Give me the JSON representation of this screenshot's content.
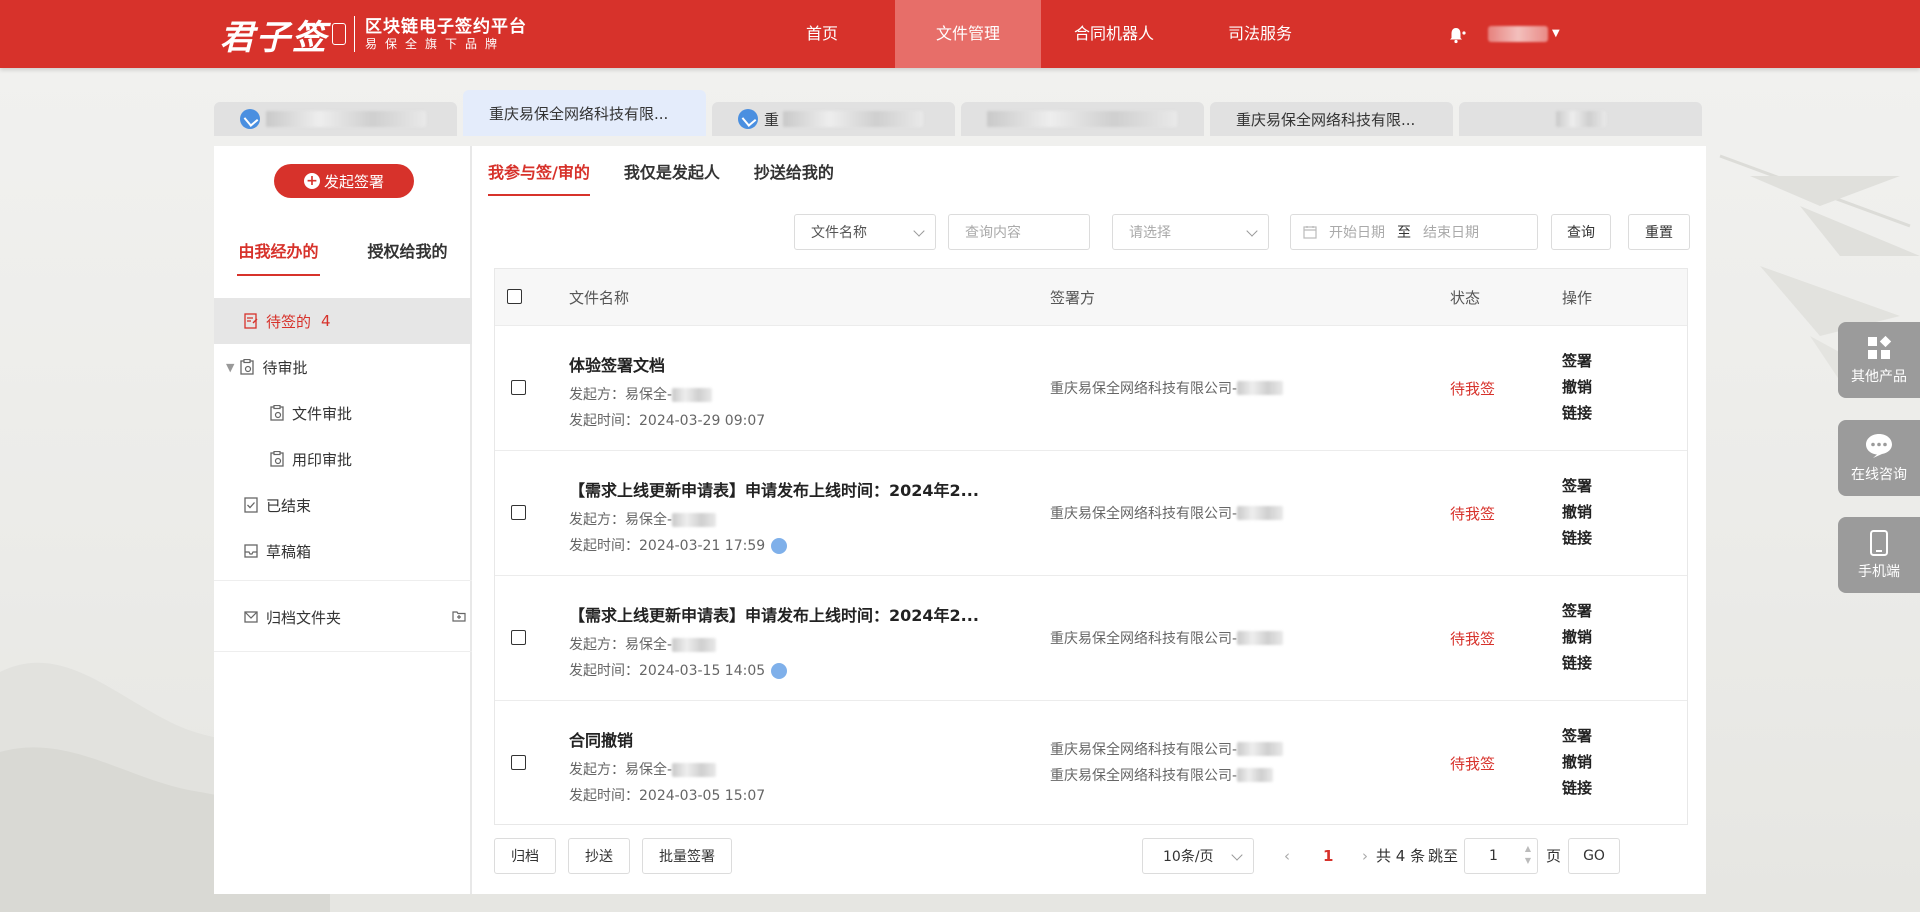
{
  "header": {
    "logo_brand": "君子签",
    "logo_title": "区块链电子签约平台",
    "logo_subtitle": "易保全旗下品牌",
    "nav": [
      "首页",
      "文件管理",
      "合同机器人",
      "司法服务"
    ],
    "active_nav": 1
  },
  "tabs": [
    {
      "label": "",
      "icon": true,
      "blurred": true
    },
    {
      "label": "重庆易保全网络科技有限...",
      "icon": false,
      "active": true
    },
    {
      "label": "重",
      "icon": true,
      "blurred": true
    },
    {
      "label": "",
      "icon": false,
      "blurred": true
    },
    {
      "label": "重庆易保全网络科技有限...",
      "icon": false
    },
    {
      "label": "",
      "icon": false,
      "blurred": true
    }
  ],
  "sidebar": {
    "start_button": "发起签署",
    "tab_mine": "由我经办的",
    "tab_authorized": "授权给我的",
    "items": [
      {
        "label": "待签的",
        "count": "4",
        "icon": "edit-doc-icon"
      },
      {
        "label": "待审批",
        "icon": "approval-icon"
      },
      {
        "label": "文件审批",
        "icon": "file-approval-icon"
      },
      {
        "label": "用印审批",
        "icon": "seal-approval-icon"
      },
      {
        "label": "已结束",
        "icon": "finished-icon"
      },
      {
        "label": "草稿箱",
        "icon": "draft-icon"
      }
    ],
    "archive": "归档文件夹"
  },
  "content": {
    "tabs": [
      "我参与签/审的",
      "我仅是发起人",
      "抄送给我的"
    ],
    "filters": {
      "field_select": "文件名称",
      "query_placeholder": "查询内容",
      "select_placeholder": "请选择",
      "start_date": "开始日期",
      "to": "至",
      "end_date": "结束日期",
      "query_btn": "查询",
      "reset_btn": "重置"
    },
    "columns": {
      "name": "文件名称",
      "signer": "签署方",
      "status": "状态",
      "ops": "操作"
    },
    "rows": [
      {
        "name": "体验签署文档",
        "initiator": "发起方：易保全-",
        "time": "发起时间：2024-03-29 09:07",
        "signers": [
          "重庆易保全网络科技有限公司-"
        ],
        "status": "待我签",
        "pin": false
      },
      {
        "name": "【需求上线更新申请表】申请发布上线时间：2024年2...",
        "initiator": "发起方：易保全-",
        "time": "发起时间：2024-03-21 17:59",
        "signers": [
          "重庆易保全网络科技有限公司-"
        ],
        "status": "待我签",
        "pin": true
      },
      {
        "name": "【需求上线更新申请表】申请发布上线时间：2024年2...",
        "initiator": "发起方：易保全-",
        "time": "发起时间：2024-03-15 14:05",
        "signers": [
          "重庆易保全网络科技有限公司-"
        ],
        "status": "待我签",
        "pin": true
      },
      {
        "name": "合同撤销",
        "initiator": "发起方：易保全-",
        "time": "发起时间：2024-03-05 15:07",
        "signers": [
          "重庆易保全网络科技有限公司-",
          "重庆易保全网络科技有限公司-"
        ],
        "status": "待我签",
        "pin": false
      }
    ],
    "ops": [
      "签署",
      "撤销",
      "链接"
    ],
    "footer": {
      "archive": "归档",
      "cc": "抄送",
      "batch_sign": "批量签署",
      "page_size": "10条/页",
      "current_page": "1",
      "total": "共 4 条",
      "jump_to": "跳至",
      "jump_value": "1",
      "page_unit": "页",
      "go": "GO"
    }
  },
  "float": [
    "其他产品",
    "在线咨询",
    "手机端"
  ],
  "colors": {
    "brand": "#d7322b",
    "nav_active": "#e76e69",
    "float": "#9b9b9b"
  }
}
